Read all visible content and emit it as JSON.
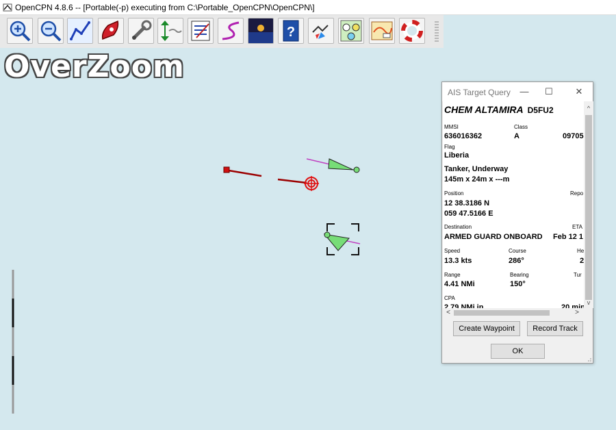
{
  "window": {
    "title": "OpenCPN 4.8.6 -- [Portable(-p) executing from C:\\Portable_OpenCPN\\OpenCPN\\]"
  },
  "toolbar": {
    "buttons": [
      {
        "icon": "zoom-in-icon"
      },
      {
        "icon": "zoom-out-icon"
      },
      {
        "icon": "route-icon"
      },
      {
        "icon": "auto-follow-icon"
      },
      {
        "icon": "settings-icon"
      },
      {
        "icon": "tide-current-icon"
      },
      {
        "icon": "route-manager-icon"
      },
      {
        "icon": "track-icon"
      },
      {
        "icon": "chart-quilt-icon"
      },
      {
        "icon": "help-icon"
      },
      {
        "icon": "ais-icon"
      },
      {
        "icon": "dashboard-icon"
      },
      {
        "icon": "weather-fax-icon"
      },
      {
        "icon": "mob-icon"
      }
    ]
  },
  "chart": {
    "overlay_text": "OverZoom"
  },
  "ais_dialog": {
    "title": "AIS Target Query",
    "vessel_name": "CHEM ALTAMIRA",
    "call_sign": "D5FU2",
    "fields": {
      "mmsi_label": "MMSI",
      "mmsi_value": "636016362",
      "class_label": "Class",
      "class_value": "A",
      "imo_partial": "09705",
      "flag_label": "Flag",
      "flag_value": "Liberia",
      "type_value": "Tanker, Underway",
      "dimensions_value": "145m x 24m x ---m",
      "position_label": "Position",
      "report_label_partial": "Repo",
      "lat_value": "12 38.3186 N",
      "lon_value": "059 47.5166 E",
      "destination_label": "Destination",
      "eta_label": "ETA",
      "destination_value": "ARMED GUARD ONBOARD",
      "eta_value_partial": "Feb 12 1",
      "speed_label": "Speed",
      "speed_value": "13.3 kts",
      "course_label": "Course",
      "course_value": "286°",
      "heading_label_partial": "He",
      "heading_value_partial": "2",
      "range_label": "Range",
      "range_value": "4.41 NMi",
      "bearing_label": "Bearing",
      "bearing_value": "150°",
      "turn_label_partial": "Tur",
      "cpa_label": "CPA",
      "cpa_value_partial": "2.79 NMi in",
      "tcpa_value_partial": "20 min"
    },
    "buttons": {
      "create_waypoint": "Create Waypoint",
      "record_track": "Record Track",
      "ok": "OK"
    }
  },
  "colors": {
    "sea": "#d4e8ee",
    "ais_target": "#77dd77",
    "own_ship_line": "#9b0000",
    "heading_vector": "#c040c0"
  }
}
